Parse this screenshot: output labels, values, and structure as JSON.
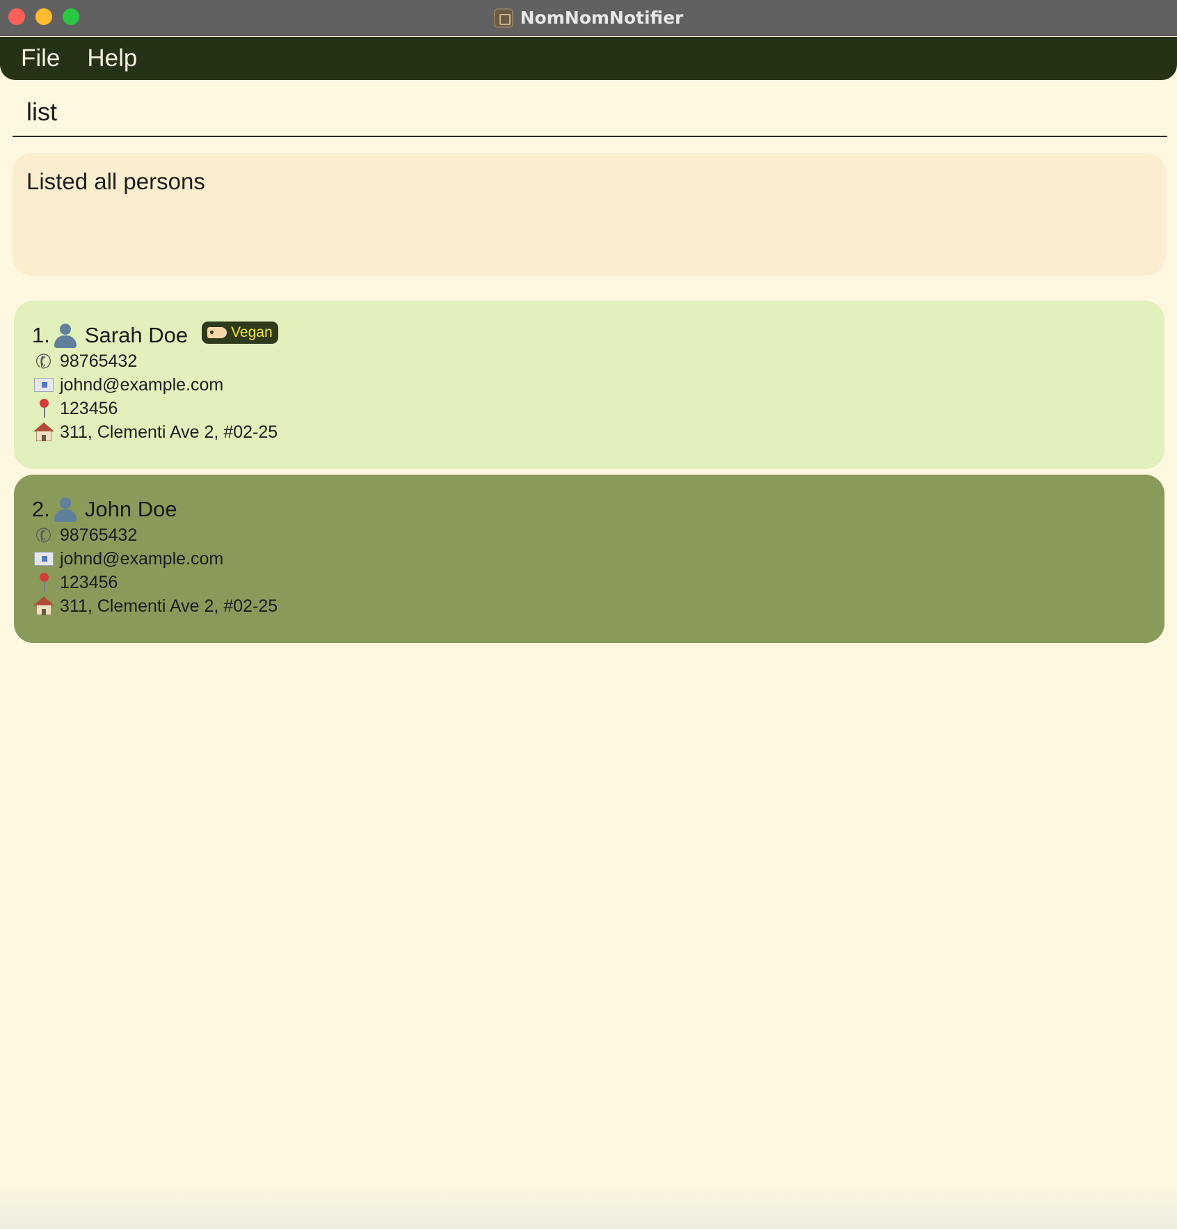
{
  "window": {
    "title": "NomNomNotifier"
  },
  "menu": {
    "items": [
      {
        "label": "File"
      },
      {
        "label": "Help"
      }
    ]
  },
  "command": {
    "value": "list",
    "placeholder": ""
  },
  "result": {
    "message": "Listed all persons"
  },
  "persons": [
    {
      "index": "1.",
      "name": "Sarah Doe",
      "tags": [
        "Vegan"
      ],
      "phone": "98765432",
      "email": "johnd@example.com",
      "postal": "123456",
      "address": "311, Clementi Ave 2, #02-25"
    },
    {
      "index": "2.",
      "name": "John Doe",
      "tags": [],
      "phone": "98765432",
      "email": "johnd@example.com",
      "postal": "123456",
      "address": "311, Clementi Ave 2, #02-25"
    }
  ],
  "colors": {
    "background": "#fff8e1",
    "menubar": "#263216",
    "result_box": "#fbeecf",
    "card_selected": "#e2f0bb",
    "card_default": "#8a9a5b",
    "tag_bg": "#2e3a1c",
    "tag_text": "#f7e733"
  },
  "icons": {
    "person": "person-icon",
    "phone": "phone-icon",
    "email": "mail-icon",
    "postal": "pin-icon",
    "address": "house-icon",
    "tag": "tag-icon"
  }
}
